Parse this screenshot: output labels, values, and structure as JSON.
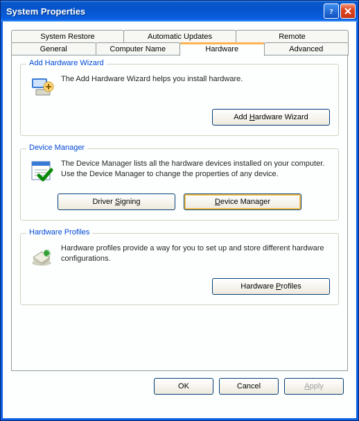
{
  "window": {
    "title": "System Properties"
  },
  "tabs": {
    "row1": [
      "System Restore",
      "Automatic Updates",
      "Remote"
    ],
    "row2": [
      "General",
      "Computer Name",
      "Hardware",
      "Advanced"
    ],
    "active": "Hardware"
  },
  "groups": {
    "addHardware": {
      "title": "Add Hardware Wizard",
      "text": "The Add Hardware Wizard helps you install hardware.",
      "button": "Add Hardware Wizard",
      "button_accel": "H"
    },
    "deviceManager": {
      "title": "Device Manager",
      "text": "The Device Manager lists all the hardware devices installed on your computer. Use the Device Manager to change the properties of any device.",
      "btnSigning": "Driver Signing",
      "btnSigning_accel": "S",
      "btnDevMgr": "Device Manager",
      "btnDevMgr_accel": "D"
    },
    "hwProfiles": {
      "title": "Hardware Profiles",
      "text": "Hardware profiles provide a way for you to set up and store different hardware configurations.",
      "button": "Hardware Profiles",
      "button_accel": "P"
    }
  },
  "buttons": {
    "ok": "OK",
    "cancel": "Cancel",
    "apply": "Apply"
  }
}
